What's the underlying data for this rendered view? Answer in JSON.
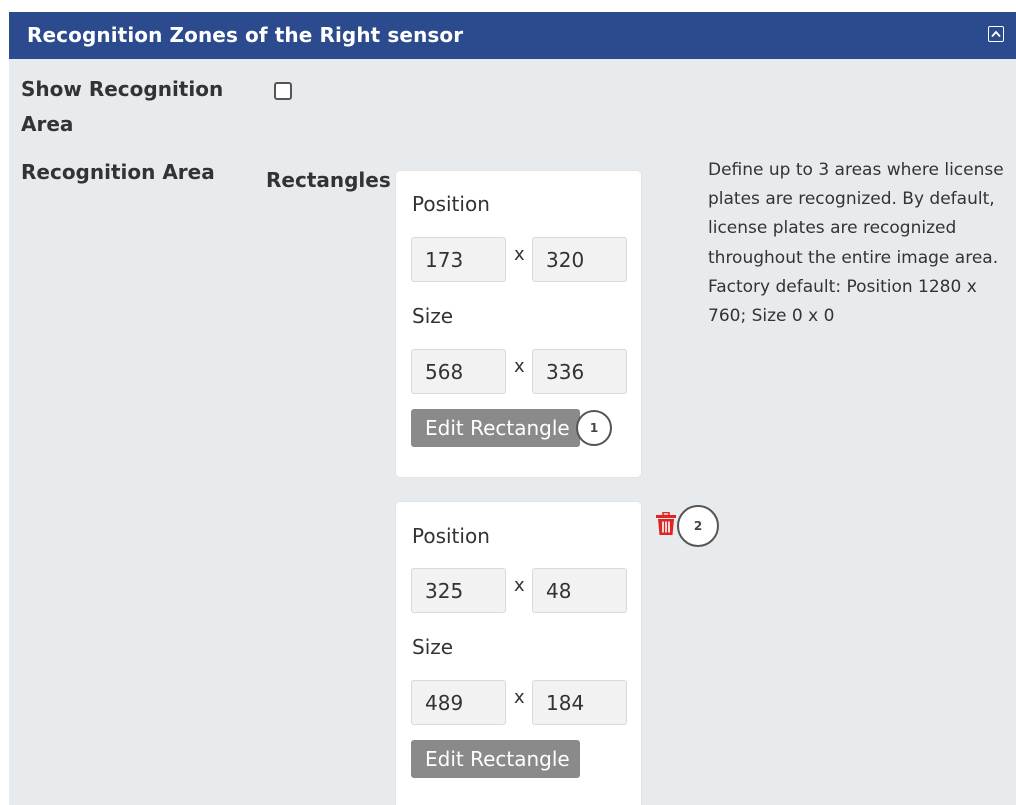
{
  "panel": {
    "title": "Recognition Zones of the Right sensor",
    "collapse_icon": "chevron-up-square-icon"
  },
  "show_area": {
    "label": "Show Recognition Area",
    "checked": false
  },
  "recognition_area": {
    "label": "Recognition Area",
    "rectangles_label": "Rectangles",
    "help_text": "Define up to 3 areas where license plates are recognized. By default, license plates are recognized throughout the entire image area. Factory default: Position 1280 x 760; Size 0 x 0"
  },
  "rectangles": [
    {
      "position_label": "Position",
      "position_x": "173",
      "position_y": "320",
      "size_label": "Size",
      "size_w": "568",
      "size_h": "336",
      "separator": "x",
      "edit_label": "Edit Rectangle",
      "marker": "1"
    },
    {
      "position_label": "Position",
      "position_x": "325",
      "position_y": "48",
      "size_label": "Size",
      "size_w": "489",
      "size_h": "184",
      "separator": "x",
      "edit_label": "Edit Rectangle",
      "marker": "2",
      "delete_icon": "trash-icon"
    }
  ],
  "colors": {
    "header": "#2c4a8e",
    "background": "#e8ebee",
    "button": "#8a8a8a",
    "delete": "#e02424"
  }
}
